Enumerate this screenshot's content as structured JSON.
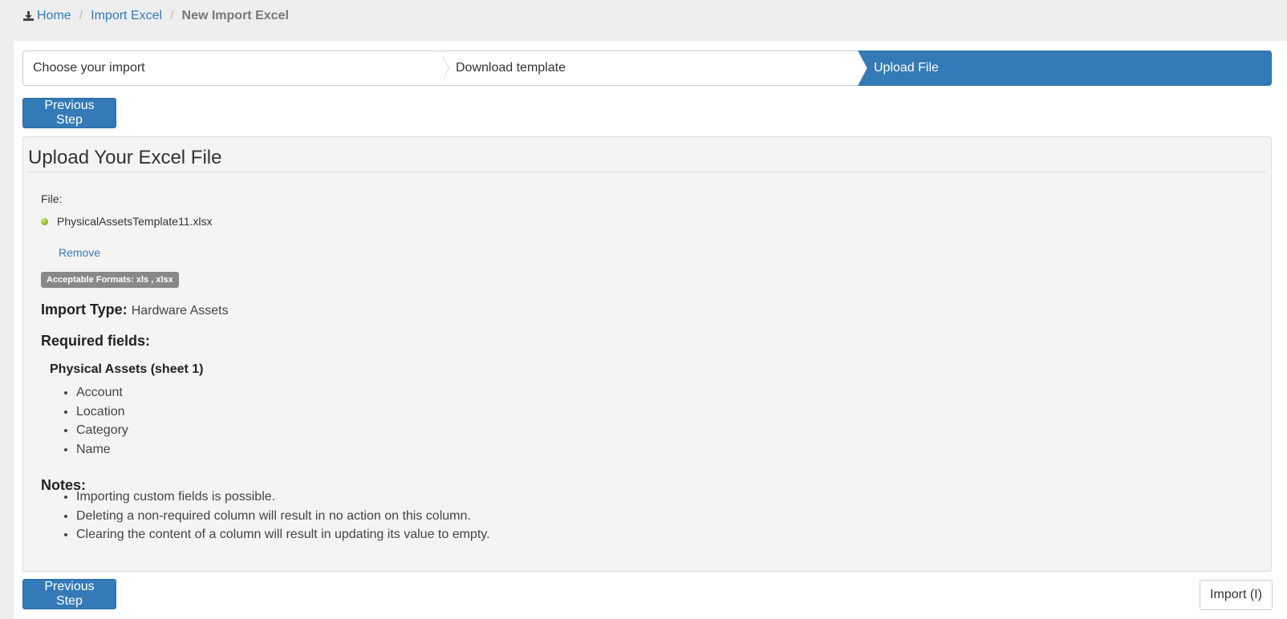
{
  "breadcrumb": {
    "home": "Home",
    "import_excel": "Import Excel",
    "current": "New Import Excel"
  },
  "wizard": {
    "steps": [
      {
        "label": "Choose your import",
        "active": false
      },
      {
        "label": "Download template",
        "active": false
      },
      {
        "label": "Upload File",
        "active": true
      }
    ]
  },
  "buttons": {
    "previous_step": "Previous Step",
    "import": "Import (I)"
  },
  "panel": {
    "title": "Upload Your Excel File",
    "file_label": "File:",
    "file_name": "PhysicalAssetsTemplate11.xlsx",
    "remove": "Remove",
    "formats_badge": "Acceptable Formats: xls , xlsx",
    "import_type_label": "Import Type:",
    "import_type_value": "Hardware Assets",
    "required_heading": "Required fields:",
    "sheet_heading": "Physical Assets (sheet 1)",
    "required_fields": [
      "Account",
      "Location",
      "Category",
      "Name"
    ],
    "notes_heading": "Notes:",
    "notes": [
      "Importing custom fields is possible.",
      "Deleting a non-required column will result in no action on this column.",
      "Clearing the content of a column will result in updating its value to empty."
    ]
  },
  "colors": {
    "primary": "#337ab7",
    "page_bg": "#eeeeee",
    "panel_bg": "#f4f4f4",
    "badge_bg": "#888888",
    "status_dot": "#8cc63f"
  }
}
